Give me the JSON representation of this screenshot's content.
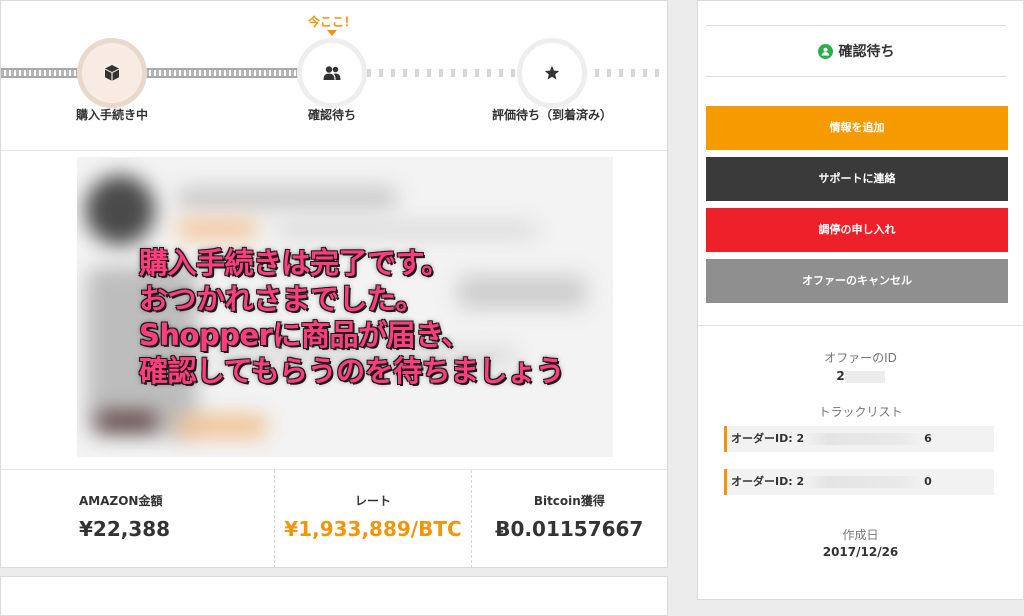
{
  "progress": {
    "here_badge": "今ここ！",
    "steps": [
      {
        "label": "購入手続き中",
        "icon": "box-icon"
      },
      {
        "label": "確認待ち",
        "icon": "users-icon"
      },
      {
        "label": "評価待ち（到着済み）",
        "icon": "star-icon"
      }
    ]
  },
  "preview": {
    "overlay_lines": [
      "購入手続きは完了です。",
      "おつかれさまでした。",
      "Shopperに商品が届き、",
      "確認してもらうのを待ちましょう"
    ]
  },
  "stats": {
    "amazon_label": "AMAZON金額",
    "amazon_value": "¥22,388",
    "rate_label": "レート",
    "rate_value": "¥1,933,889/BTC",
    "bitcoin_label": "Bitcoin獲得",
    "bitcoin_value": "Ƀ0.01157667"
  },
  "sidebar": {
    "status": "確認待ち",
    "buttons": {
      "add_info": "情報を追加",
      "contact_support": "サポートに連絡",
      "mediation": "調停の申し入れ",
      "cancel_offer": "オファーのキャンセル"
    },
    "offer_id_label": "オファーのID",
    "offer_id_value": "2",
    "track_list_label": "トラックリスト",
    "orders": [
      {
        "prefix": "オーダーID: 2",
        "suffix": "6"
      },
      {
        "prefix": "オーダーID: 2",
        "suffix": "0"
      }
    ],
    "created_label": "作成日",
    "created_value": "2017/12/26"
  },
  "colors": {
    "accent_orange": "#f59b00",
    "dark": "#3a3a3a",
    "red": "#ee2029",
    "gray": "#8f8f8f",
    "green": "#27b04a",
    "overlay_pink": "#ff3d7f"
  }
}
